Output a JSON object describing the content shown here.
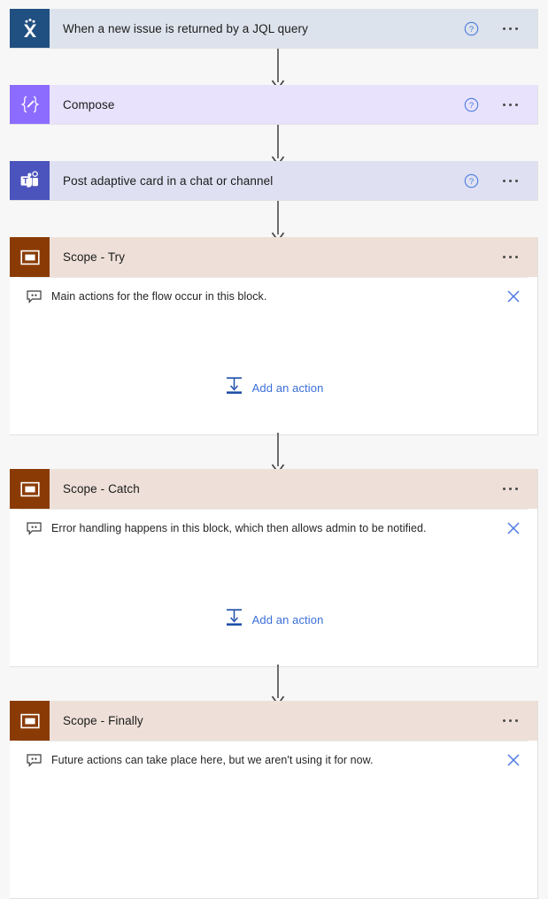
{
  "flow": {
    "nodes": [
      {
        "type": "trigger",
        "title": "When a new issue is returned by a JQL query",
        "icon": "jira-icon",
        "icon_bg": "#205081",
        "body_bg": "#dde3ec",
        "help_label": "?",
        "menu_label": "More commands"
      },
      {
        "type": "action",
        "title": "Compose",
        "icon": "compose-icon",
        "icon_bg": "#8c6cff",
        "body_bg": "#e8e2fd",
        "help_label": "?",
        "menu_label": "More commands"
      },
      {
        "type": "action",
        "title": "Post adaptive card in a chat or channel",
        "icon": "teams-icon",
        "icon_bg": "#4b53bc",
        "body_bg": "#dfe1f2",
        "help_label": "?",
        "menu_label": "More commands"
      }
    ],
    "scopes": [
      {
        "title": "Scope - Try",
        "icon": "scope-icon",
        "icon_bg": "#8a3b05",
        "header_bg": "#eee0d8",
        "comment": "Main actions for the flow occur in this block.",
        "comment_icon": "comment-icon",
        "close_label": "Delete comment",
        "add_action_label": "Add an action",
        "add_action_icon": "add-action-icon",
        "menu_label": "More commands"
      },
      {
        "title": "Scope - Catch",
        "icon": "scope-icon",
        "icon_bg": "#8a3b05",
        "header_bg": "#eee0d8",
        "comment": "Error handling happens in this block, which then allows admin to be notified.",
        "comment_icon": "comment-icon",
        "close_label": "Delete comment",
        "add_action_label": "Add an action",
        "add_action_icon": "add-action-icon",
        "menu_label": "More commands"
      },
      {
        "title": "Scope - Finally",
        "icon": "scope-icon",
        "icon_bg": "#8a3b05",
        "header_bg": "#eee0d8",
        "comment": "Future actions can take place here, but we aren't using it for now.",
        "comment_icon": "comment-icon",
        "close_label": "Delete comment",
        "menu_label": "More commands"
      }
    ],
    "colors": {
      "canvas_bg": "#f7f7f7",
      "card_border": "#e1e1e1",
      "link_blue": "#3a6fd8",
      "connector": "#4a4a4a",
      "scope_icon_bg": "#8a3b05",
      "scope_header_bg": "#eee0d8"
    }
  }
}
